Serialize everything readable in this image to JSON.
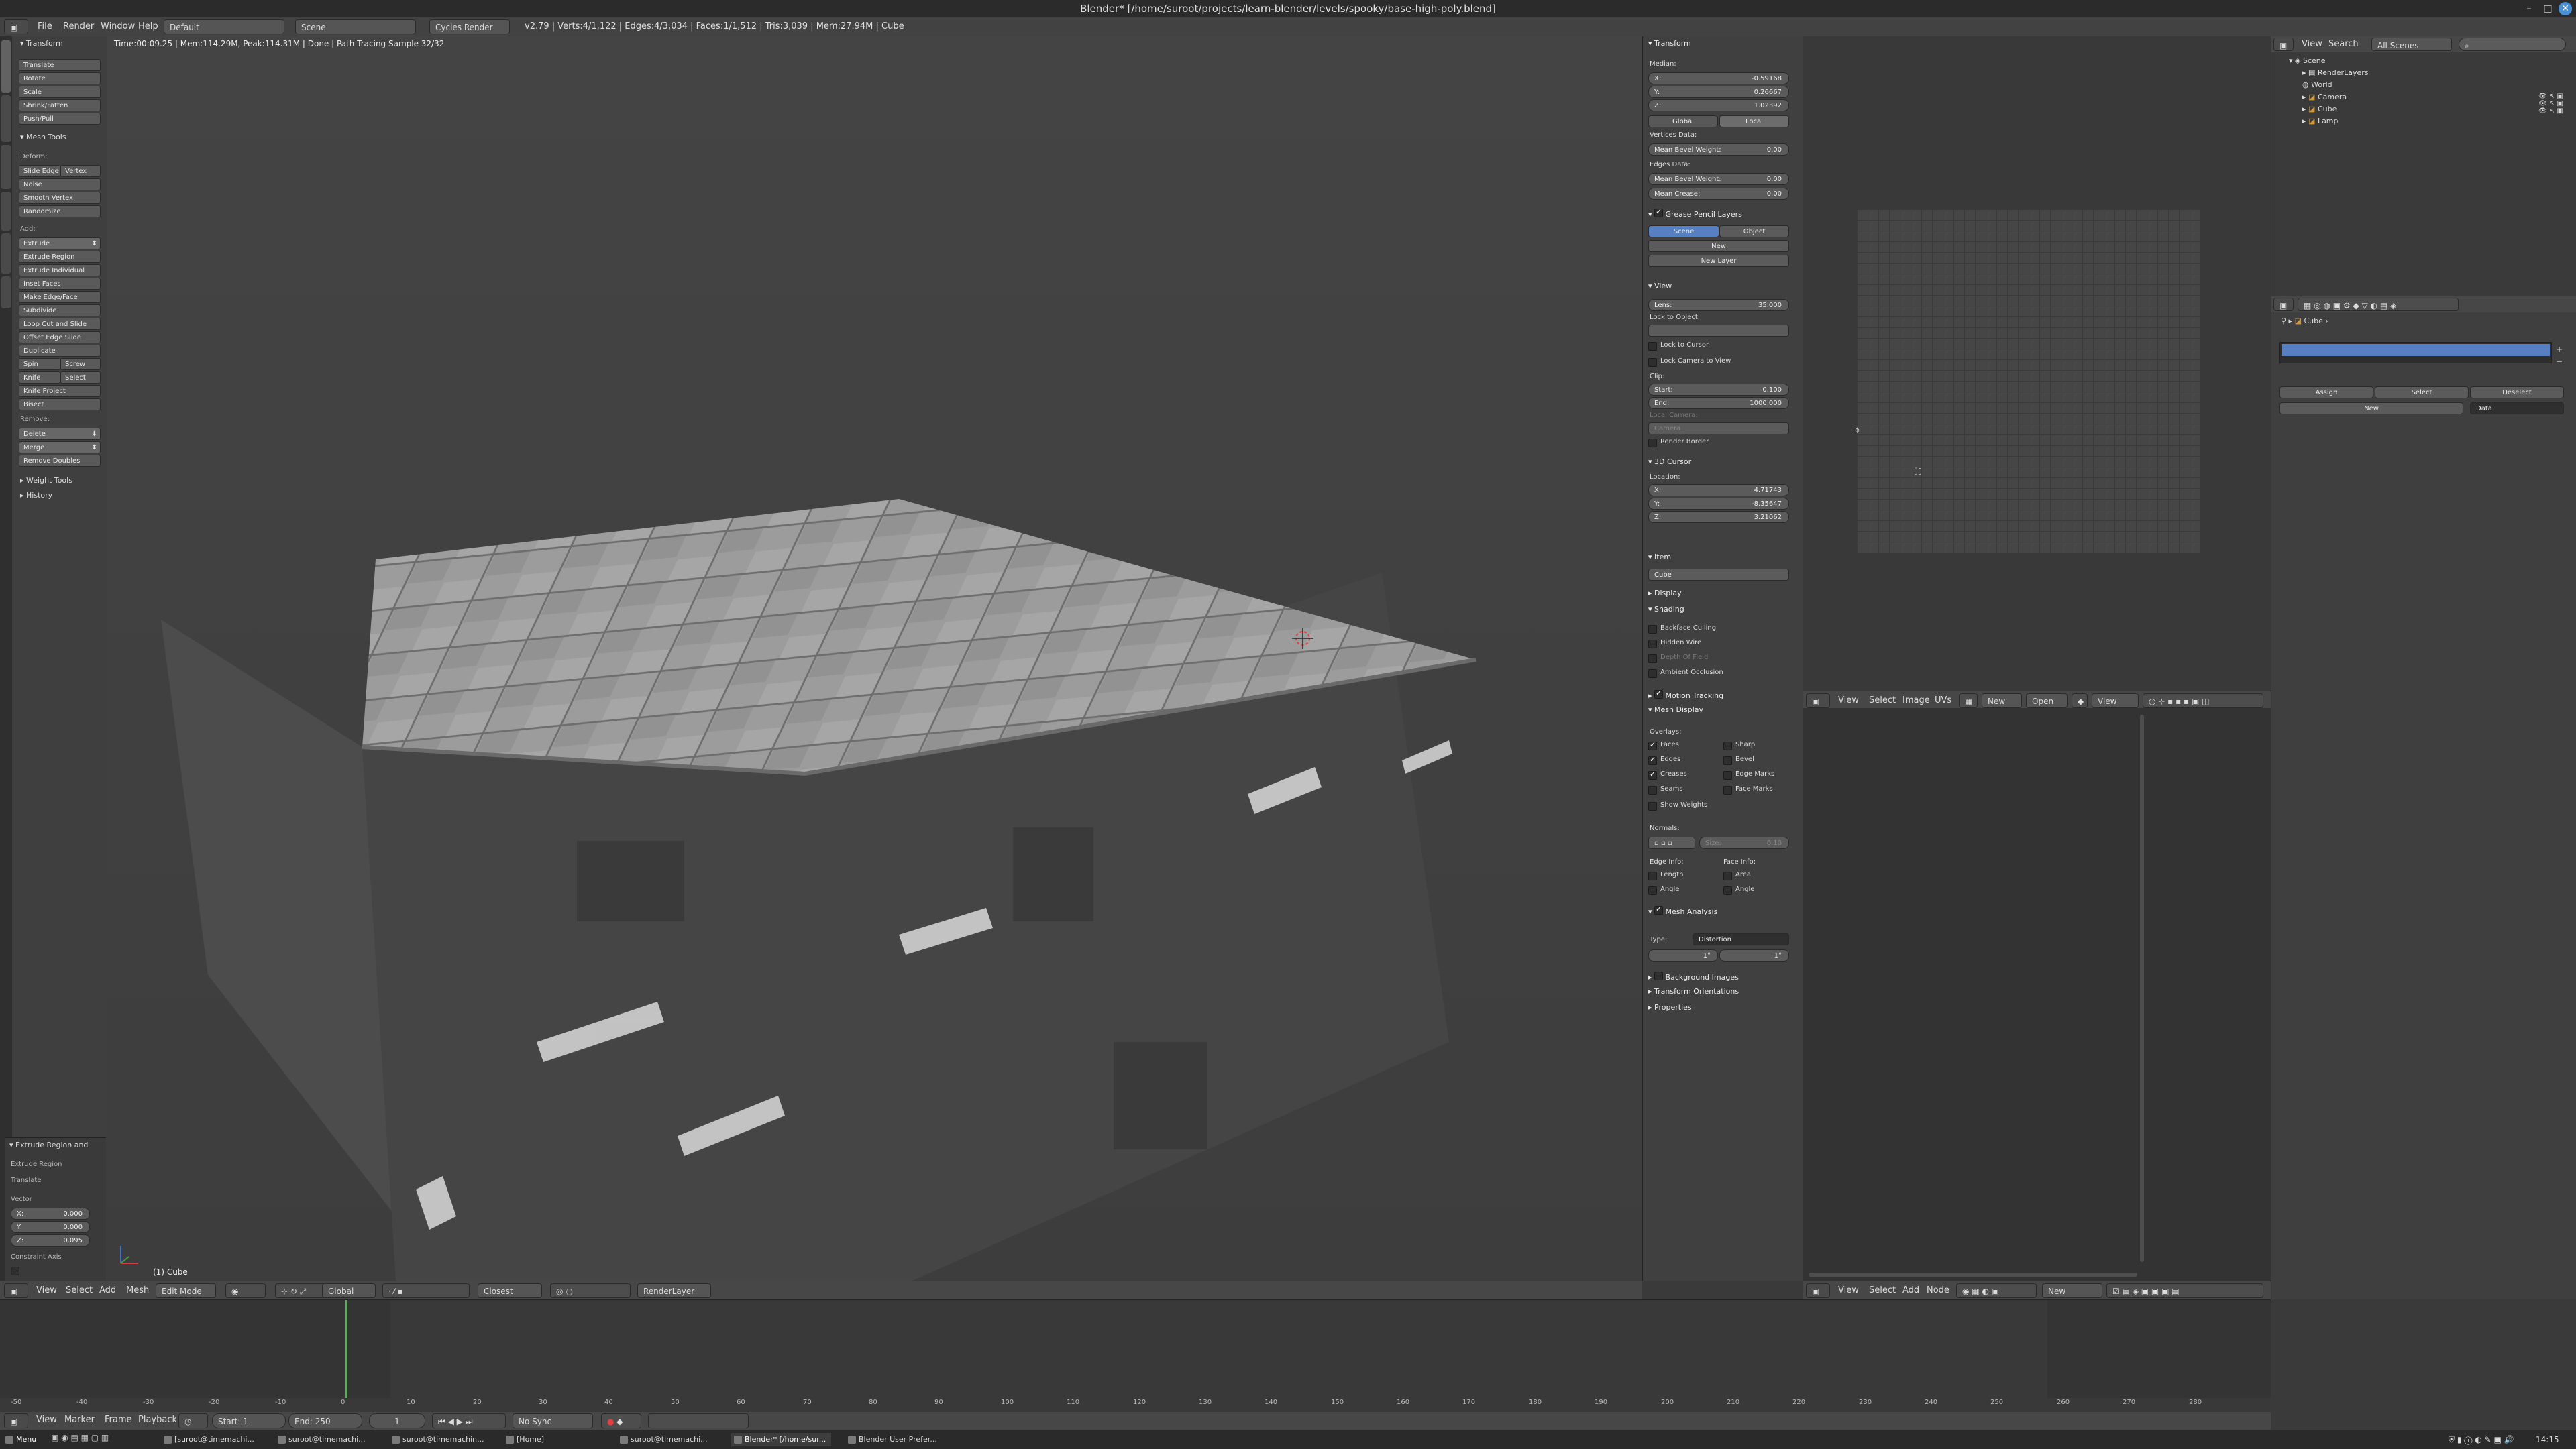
{
  "window": {
    "title": "Blender* [/home/suroot/projects/learn-blender/levels/spooky/base-high-poly.blend]"
  },
  "topbar": {
    "menus": [
      "File",
      "Render",
      "Window",
      "Help"
    ],
    "layout": "Default",
    "scene": "Scene",
    "engine": "Cycles Render",
    "stats": "v2.79 | Verts:4/1,122 | Edges:4/3,034 | Faces:1/1,512 | Tris:3,039 | Mem:27.94M | Cube"
  },
  "toolshelf": {
    "transform_header": "Transform",
    "transform": [
      "Translate",
      "Rotate",
      "Scale",
      "Shrink/Fatten",
      "Push/Pull"
    ],
    "meshtools_header": "Mesh Tools",
    "deform_label": "Deform:",
    "deform_pair": [
      "Slide Edge",
      "Vertex"
    ],
    "deform": [
      "Noise",
      "Smooth Vertex",
      "Randomize"
    ],
    "add_label": "Add:",
    "extrude": "Extrude",
    "add": [
      "Extrude Region",
      "Extrude Individual",
      "Inset Faces",
      "Make Edge/Face",
      "Subdivide",
      "Loop Cut and Slide",
      "Offset Edge Slide",
      "Duplicate"
    ],
    "spin_pair": [
      "Spin",
      "Screw"
    ],
    "knife_pair": [
      "Knife",
      "Select"
    ],
    "add2": [
      "Knife Project",
      "Bisect"
    ],
    "remove_label": "Remove:",
    "remove_dd": [
      "Delete",
      "Merge"
    ],
    "remove": [
      "Remove Doubles"
    ],
    "weight_tools": "Weight Tools",
    "history": "History",
    "op_header": "Extrude Region and",
    "op_rows": [
      "Extrude Region",
      "Translate"
    ],
    "vector_label": "Vector",
    "vector": [
      {
        "axis": "X:",
        "val": "0.000"
      },
      {
        "axis": "Y:",
        "val": "0.000"
      },
      {
        "axis": "Z:",
        "val": "0.095"
      }
    ],
    "constraint_label": "Constraint Axis"
  },
  "viewport": {
    "info": "Time:00:09.25 | Mem:114.29M, Peak:114.31M | Done | Path Tracing Sample 32/32",
    "object_label": "(1) Cube",
    "header": {
      "menus": [
        "View",
        "Select",
        "Add",
        "Mesh"
      ],
      "mode": "Edit Mode",
      "orientation": "Global",
      "snap": "Closest",
      "layer": "RenderLayer"
    }
  },
  "nprops": {
    "transform": "Transform",
    "median": "Median:",
    "median_vals": [
      {
        "axis": "X:",
        "val": "-0.59168"
      },
      {
        "axis": "Y:",
        "val": "0.26667"
      },
      {
        "axis": "Z:",
        "val": "1.02392"
      }
    ],
    "global": "Global",
    "local": "Local",
    "vertices_data": "Vertices Data:",
    "mean_bevel_weight": "Mean Bevel Weight:",
    "mbw_val": "0.00",
    "edges_data": "Edges Data:",
    "mean_bevel_weight2": "Mean Bevel Weight:",
    "mbw2_val": "0.00",
    "mean_crease": "Mean Crease:",
    "mc_val": "0.00",
    "grease_pencil": "Grease Pencil Layers",
    "scene_tab": "Scene",
    "object_tab": "Object",
    "new": "New",
    "new_layer": "New Layer",
    "view": "View",
    "lens": "Lens:",
    "lens_val": "35.000",
    "lock_to_object": "Lock to Object:",
    "lock_to_cursor": "Lock to Cursor",
    "lock_camera": "Lock Camera to View",
    "clip": "Clip:",
    "clip_start": "Start:",
    "clip_start_val": "0.100",
    "clip_end": "End:",
    "clip_end_val": "1000.000",
    "local_camera": "Local Camera:",
    "camera": "Camera",
    "render_border": "Render Border",
    "cursor3d": "3D Cursor",
    "location": "Location:",
    "cursor_vals": [
      {
        "axis": "X:",
        "val": "4.71743"
      },
      {
        "axis": "Y:",
        "val": "-8.35647"
      },
      {
        "axis": "Z:",
        "val": "3.21062"
      }
    ],
    "item": "Item",
    "item_name": "Cube",
    "display": "Display",
    "shading": "Shading",
    "backface": "Backface Culling",
    "hidden_wire": "Hidden Wire",
    "depth_of_field": "Depth Of Field",
    "ambient_occlusion": "Ambient Occlusion",
    "motion_tracking": "Motion Tracking",
    "mesh_display": "Mesh Display",
    "overlays": "Overlays:",
    "ov_left": [
      "Faces",
      "Edges",
      "Creases",
      "Seams"
    ],
    "ov_right": [
      "Sharp",
      "Bevel",
      "Edge Marks",
      "Face Marks"
    ],
    "show_weights": "Show Weights",
    "normals": "Normals:",
    "normals_size": "Size:",
    "normals_size_val": "0.10",
    "edge_info": "Edge Info:",
    "face_info": "Face Info:",
    "edge_info_items": [
      "Length",
      "Angle"
    ],
    "face_info_items": [
      "Area",
      "Angle"
    ],
    "mesh_analysis": "Mesh Analysis",
    "type": "Type:",
    "type_val": "Distortion",
    "range_a": "1°",
    "range_b": "1°",
    "background_images": "Background Images",
    "transform_orientations": "Transform Orientations",
    "properties": "Properties"
  },
  "uv": {
    "menus": [
      "View",
      "Select",
      "Image",
      "UVs"
    ],
    "new": "New",
    "open": "Open",
    "view": "View"
  },
  "node": {
    "menus": [
      "View",
      "Select",
      "Add",
      "Node"
    ],
    "new": "New"
  },
  "outliner": {
    "menus": [
      "View",
      "Search"
    ],
    "scope": "All Scenes",
    "rows": [
      {
        "label": "Scene",
        "indent": 0
      },
      {
        "label": "RenderLayers",
        "indent": 1
      },
      {
        "label": "World",
        "indent": 1
      },
      {
        "label": "Camera",
        "indent": 1
      },
      {
        "label": "Cube",
        "indent": 1
      },
      {
        "label": "Lamp",
        "indent": 1
      }
    ]
  },
  "props": {
    "breadcrumb": "Cube",
    "assign": "Assign",
    "select": "Select",
    "deselect": "Deselect",
    "new": "New",
    "data": "Data"
  },
  "timeline": {
    "ticks": [
      "-50",
      "-40",
      "-30",
      "-20",
      "-10",
      "0",
      "10",
      "20",
      "30",
      "40",
      "50",
      "60",
      "70",
      "80",
      "90",
      "100",
      "110",
      "120",
      "130",
      "140",
      "150",
      "160",
      "170",
      "180",
      "190",
      "200",
      "210",
      "220",
      "230",
      "240",
      "250",
      "260",
      "270",
      "280"
    ],
    "menus": [
      "View",
      "Marker",
      "Frame",
      "Playback"
    ],
    "start_label": "Start:",
    "start": "1",
    "end_label": "End:",
    "end": "250",
    "frame": "1",
    "sync": "No Sync",
    "current_frame_pct": 0.152
  },
  "taskbar": {
    "menu": "Menu",
    "tasks": [
      "[suroot@timemachi...",
      "suroot@timemachi...",
      "suroot@timemachin...",
      "[Home]",
      "suroot@timemachi...",
      "Blender* [/home/sur...",
      "Blender User Prefer..."
    ],
    "clock": "14:15"
  }
}
